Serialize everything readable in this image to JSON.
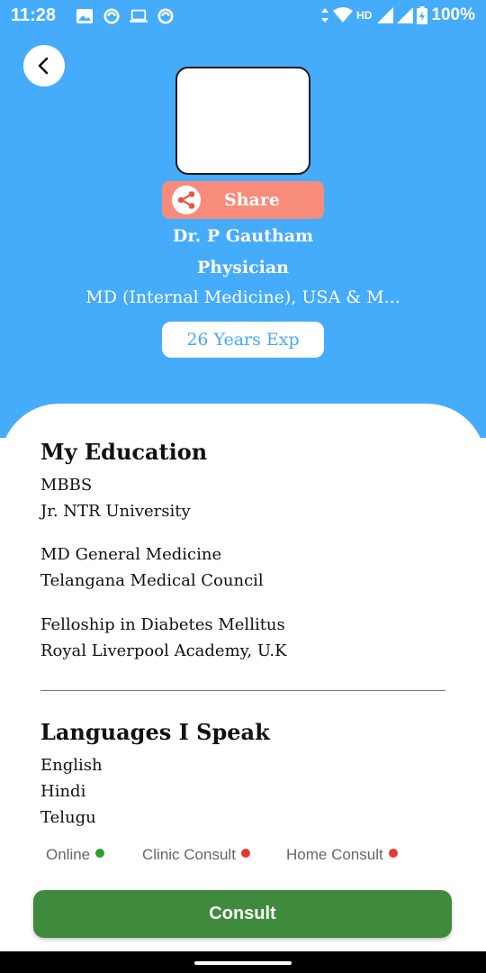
{
  "status_bar": {
    "time": "11:28",
    "network": "HD",
    "battery": "100%",
    "notification_icons": [
      "image-icon",
      "sync-icon",
      "laptop-icon",
      "sync-icon"
    ]
  },
  "colors": {
    "header_bg": "#45abfb",
    "share_button": "#f78c7b",
    "consult_button": "#3f8a3d",
    "online_dot": "#2e9e2e",
    "offline_dot": "#e53935"
  },
  "profile": {
    "share_label": "Share",
    "name": "Dr. P Gautham",
    "role": "Physician",
    "qualifications": "MD (Internal Medicine), USA & M...",
    "experience": "26 Years Exp"
  },
  "education": {
    "title": "My Education",
    "entries": [
      {
        "degree": "MBBS",
        "institution": "Jr. NTR University"
      },
      {
        "degree": "MD General Medicine",
        "institution": "Telangana Medical Council"
      },
      {
        "degree": "Felloship in Diabetes Mellitus",
        "institution": "Royal Liverpool Academy,  U.K"
      }
    ]
  },
  "languages": {
    "title": "Languages I Speak",
    "items": [
      "English",
      "Hindi",
      "Telugu"
    ]
  },
  "consult_types": [
    {
      "label": "Online",
      "status": "available"
    },
    {
      "label": "Clinic Consult",
      "status": "unavailable"
    },
    {
      "label": "Home Consult",
      "status": "unavailable"
    }
  ],
  "consult_button": {
    "label": "Consult"
  }
}
